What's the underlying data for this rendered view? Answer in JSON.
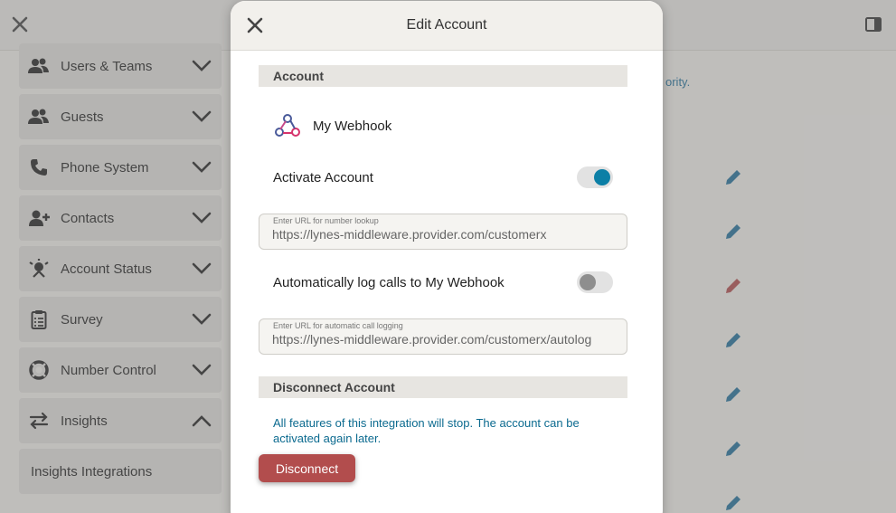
{
  "background": {
    "sidebar": [
      {
        "label": "Users & Teams",
        "icon": "users-icon",
        "expanded": false
      },
      {
        "label": "Guests",
        "icon": "guests-icon",
        "expanded": false
      },
      {
        "label": "Phone System",
        "icon": "phone-icon",
        "expanded": false
      },
      {
        "label": "Contacts",
        "icon": "add-contact-icon",
        "expanded": false
      },
      {
        "label": "Account Status",
        "icon": "status-icon",
        "expanded": false
      },
      {
        "label": "Survey",
        "icon": "clipboard-icon",
        "expanded": false
      },
      {
        "label": "Number Control",
        "icon": "lifebuoy-icon",
        "expanded": false
      },
      {
        "label": "Insights",
        "icon": "swap-arrows-icon",
        "expanded": true
      }
    ],
    "sub_item": "Insights Integrations",
    "partial_text": "ority.",
    "colors": {
      "pencil": "#1f6f9a",
      "pencil_alt": "#b24d4d"
    }
  },
  "modal": {
    "title": "Edit Account",
    "account_section": "Account",
    "account_name": "My Webhook",
    "activate_label": "Activate Account",
    "activate_on": true,
    "lookup_field": {
      "label": "Enter URL for number lookup",
      "value": "https://lynes-middleware.provider.com/customerx"
    },
    "autolog_label": "Automatically log calls to My Webhook",
    "autolog_on": false,
    "autolog_field": {
      "label": "Enter URL for automatic call logging",
      "value": "https://lynes-middleware.provider.com/customerx/autolog"
    },
    "disconnect_section": "Disconnect Account",
    "disconnect_warning": "All features of this integration will stop. The account can be activated again later.",
    "disconnect_button": "Disconnect",
    "colors": {
      "accent": "#0c7fa6",
      "danger": "#b24d4d"
    }
  }
}
